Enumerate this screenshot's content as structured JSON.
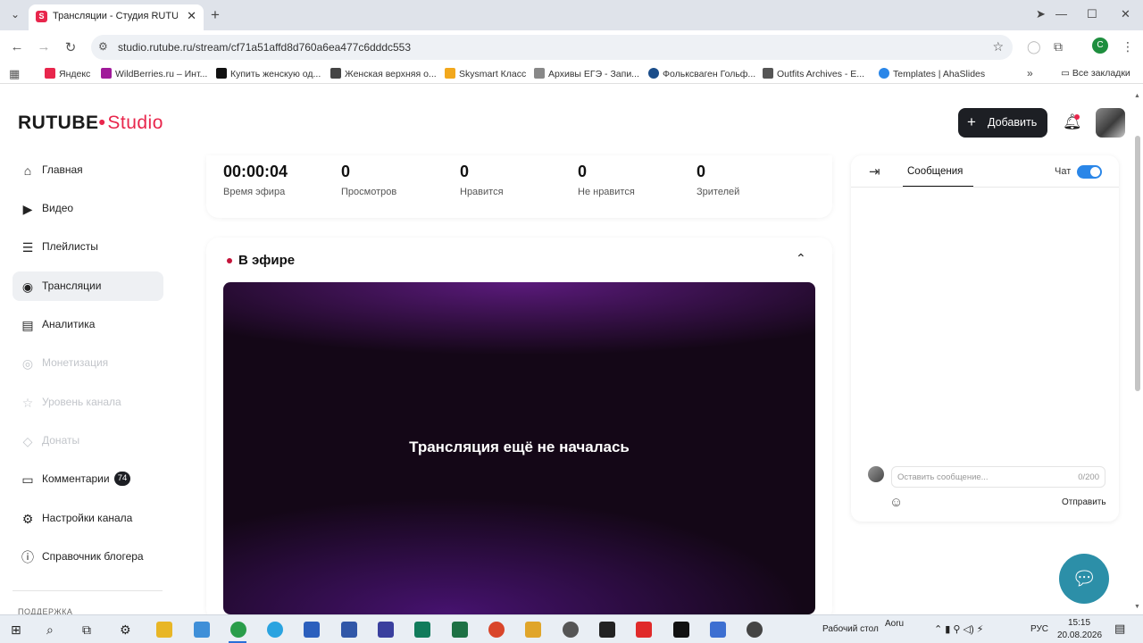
{
  "browser": {
    "tab_title": "Трансляции - Студия RUTUBE",
    "tab_favicon": "rutube-logo-icon",
    "url": "studio.rutube.ru/stream/cf71a51affd8d760a6ea477c6dddc553",
    "profile_initial": "С",
    "bookmarks": [
      {
        "label": "Яндекс",
        "color": "#e8264c"
      },
      {
        "label": "WildBerries.ru – Инт...",
        "color": "#a01a9a"
      },
      {
        "label": "Купить женскую од...",
        "color": "#111111"
      },
      {
        "label": "Женская верхняя о...",
        "color": "#444444"
      },
      {
        "label": "Skysmart Класс",
        "color": "#f2a81d"
      },
      {
        "label": "Архивы ЕГЭ - Запи...",
        "color": "#888888"
      },
      {
        "label": "Фольксваген Гольф...",
        "color": "#1b4d8a"
      },
      {
        "label": "Outfits Archives - E...",
        "color": "#555555"
      },
      {
        "label": "Templates | AhaSlides",
        "color": "#2a86e8"
      }
    ],
    "all_bookmarks": "Все закладки"
  },
  "app": {
    "logo_main": "RUTUBE",
    "logo_sub": "Studio",
    "add_label": "Добавить",
    "brand_color": "#e8264c"
  },
  "sidebar": {
    "items": [
      {
        "label": "Главная",
        "icon": "home-icon",
        "state": "normal"
      },
      {
        "label": "Видео",
        "icon": "video-icon",
        "state": "normal"
      },
      {
        "label": "Плейлисты",
        "icon": "playlist-icon",
        "state": "normal"
      },
      {
        "label": "Трансляции",
        "icon": "broadcast-icon",
        "state": "active"
      },
      {
        "label": "Аналитика",
        "icon": "analytics-icon",
        "state": "normal"
      },
      {
        "label": "Монетизация",
        "icon": "monetization-icon",
        "state": "disabled"
      },
      {
        "label": "Уровень канала",
        "icon": "trophy-icon",
        "state": "disabled"
      },
      {
        "label": "Донаты",
        "icon": "donate-icon",
        "state": "disabled"
      },
      {
        "label": "Комментарии",
        "icon": "comments-icon",
        "state": "normal",
        "badge": "74"
      },
      {
        "label": "Настройки канала",
        "icon": "gear-icon",
        "state": "normal"
      },
      {
        "label": "Справочник блогера",
        "icon": "info-icon",
        "state": "normal"
      }
    ],
    "cut_text": "ПОДДЕРЖКА"
  },
  "stats": [
    {
      "value": "00:00:04",
      "label": "Время эфира"
    },
    {
      "value": "0",
      "label": "Просмотров"
    },
    {
      "value": "0",
      "label": "Нравится"
    },
    {
      "value": "0",
      "label": "Не нравится"
    },
    {
      "value": "0",
      "label": "Зрителей"
    }
  ],
  "live": {
    "title": "В эфире",
    "player_message": "Трансляция ещё не началась"
  },
  "chat": {
    "tab": "Сообщения",
    "toggle_label": "Чат",
    "toggle_on": true,
    "input_placeholder": "Оставить сообщение...",
    "counter": "0/200",
    "send_label": "Отправить"
  },
  "taskbar": {
    "desktop_label": "Рабочий стол",
    "tray_user": "Aoru",
    "language": "РУС",
    "time": "15:15",
    "date": "20.08.2026"
  }
}
